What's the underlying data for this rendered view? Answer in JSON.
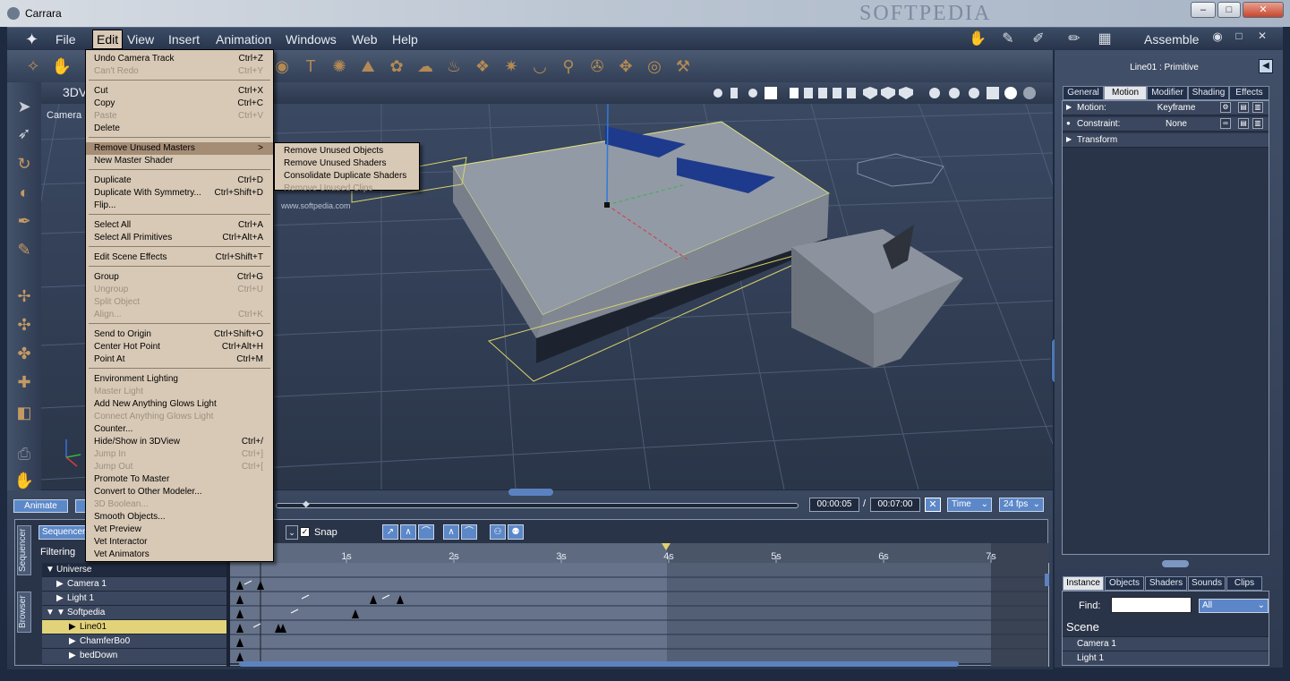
{
  "window": {
    "title": "Carrara",
    "watermark": "SOFTPEDIA",
    "min": "–",
    "max": "□",
    "close": "✕"
  },
  "menubar": {
    "items": [
      "File",
      "Edit",
      "View",
      "Insert",
      "Animation",
      "Windows",
      "Web",
      "Help"
    ],
    "room": "Assemble"
  },
  "viewport": {
    "title": "3DV",
    "camera": "Camera 1",
    "watermark_text": "www.softpedia.com"
  },
  "edit_menu": {
    "items": [
      {
        "label": "Undo Camera Track",
        "shortcut": "Ctrl+Z",
        "enabled": true
      },
      {
        "label": "Can't Redo",
        "shortcut": "Ctrl+Y",
        "enabled": false
      },
      {
        "label": "Cut",
        "shortcut": "Ctrl+X",
        "enabled": true
      },
      {
        "label": "Copy",
        "shortcut": "Ctrl+C",
        "enabled": true
      },
      {
        "label": "Paste",
        "shortcut": "Ctrl+V",
        "enabled": false
      },
      {
        "label": "Delete",
        "shortcut": "",
        "enabled": true
      },
      {
        "label": "Remove Unused Masters",
        "shortcut": ">",
        "enabled": true
      },
      {
        "label": "New Master Shader",
        "shortcut": "",
        "enabled": true
      },
      {
        "label": "Duplicate",
        "shortcut": "Ctrl+D",
        "enabled": true
      },
      {
        "label": "Duplicate With Symmetry...",
        "shortcut": "Ctrl+Shift+D",
        "enabled": true
      },
      {
        "label": "Flip...",
        "shortcut": "",
        "enabled": true
      },
      {
        "label": "Select All",
        "shortcut": "Ctrl+A",
        "enabled": true
      },
      {
        "label": "Select All Primitives",
        "shortcut": "Ctrl+Alt+A",
        "enabled": true
      },
      {
        "label": "Edit Scene Effects",
        "shortcut": "Ctrl+Shift+T",
        "enabled": true
      },
      {
        "label": "Group",
        "shortcut": "Ctrl+G",
        "enabled": true
      },
      {
        "label": "Ungroup",
        "shortcut": "Ctrl+U",
        "enabled": false
      },
      {
        "label": "Split Object",
        "shortcut": "",
        "enabled": false
      },
      {
        "label": "Align...",
        "shortcut": "Ctrl+K",
        "enabled": false
      },
      {
        "label": "Send to Origin",
        "shortcut": "Ctrl+Shift+O",
        "enabled": true
      },
      {
        "label": "Center Hot Point",
        "shortcut": "Ctrl+Alt+H",
        "enabled": true
      },
      {
        "label": "Point At",
        "shortcut": "Ctrl+M",
        "enabled": true
      },
      {
        "label": "Environment Lighting",
        "shortcut": "",
        "enabled": true
      },
      {
        "label": "Master Light",
        "shortcut": "",
        "enabled": false
      },
      {
        "label": "Add New Anything Glows Light",
        "shortcut": "",
        "enabled": true
      },
      {
        "label": "Connect Anything Glows Light",
        "shortcut": "",
        "enabled": false
      },
      {
        "label": "Counter...",
        "shortcut": "",
        "enabled": true
      },
      {
        "label": "Hide/Show in 3DView",
        "shortcut": "Ctrl+/",
        "enabled": true
      },
      {
        "label": "Jump In",
        "shortcut": "Ctrl+]",
        "enabled": false
      },
      {
        "label": "Jump Out",
        "shortcut": "Ctrl+[",
        "enabled": false
      },
      {
        "label": "Promote To Master",
        "shortcut": "",
        "enabled": true
      },
      {
        "label": "Convert to Other Modeler...",
        "shortcut": "",
        "enabled": true
      },
      {
        "label": "3D Boolean...",
        "shortcut": "",
        "enabled": false
      },
      {
        "label": "Smooth Objects...",
        "shortcut": "",
        "enabled": true
      },
      {
        "label": "Vet Preview",
        "shortcut": "",
        "enabled": true
      },
      {
        "label": "Vet Interactor",
        "shortcut": "",
        "enabled": true
      },
      {
        "label": "Vet Animators",
        "shortcut": "",
        "enabled": true
      }
    ],
    "submenu": [
      {
        "label": "Remove Unused Objects",
        "enabled": true
      },
      {
        "label": "Remove Unused Shaders",
        "enabled": true
      },
      {
        "label": "Consolidate Duplicate Shaders",
        "enabled": true
      },
      {
        "label": "Remove Unused Clips",
        "enabled": false
      }
    ]
  },
  "right_panel": {
    "title": "Line01 : Primitive",
    "tabs": [
      "General",
      "Motion",
      "Modifier",
      "Shading",
      "Effects"
    ],
    "active_tab": "Motion",
    "properties": [
      {
        "label": "Motion:",
        "value": "Keyframe"
      },
      {
        "label": "Constraint:",
        "value": "None"
      },
      {
        "label": "Transform",
        "value": ""
      }
    ],
    "browser_tabs": [
      "Instance",
      "Objects",
      "Shaders",
      "Sounds",
      "Clips"
    ],
    "find_label": "Find:",
    "find_value": "",
    "filter": "All",
    "scene_title": "Scene",
    "scene_items": [
      "Camera 1",
      "Light 1"
    ]
  },
  "timeline": {
    "animate": "Animate",
    "current_time": "00:00:05",
    "separator": "/",
    "end_time": "00:07:00",
    "time_mode": "Time",
    "fps": "24 fps",
    "sequencer": "Sequencer",
    "filtering": "Filtering",
    "snap": "Snap",
    "vertical_tabs": [
      "Sequencer",
      "Browser"
    ],
    "ruler": [
      "1s",
      "2s",
      "3s",
      "4s",
      "5s",
      "6s",
      "7s"
    ],
    "tracks": [
      "Universe",
      "Camera 1",
      "Light 1",
      "Softpedia",
      "Line01",
      "ChamferBo0",
      "bedDown"
    ],
    "selected_track": "Line01"
  }
}
